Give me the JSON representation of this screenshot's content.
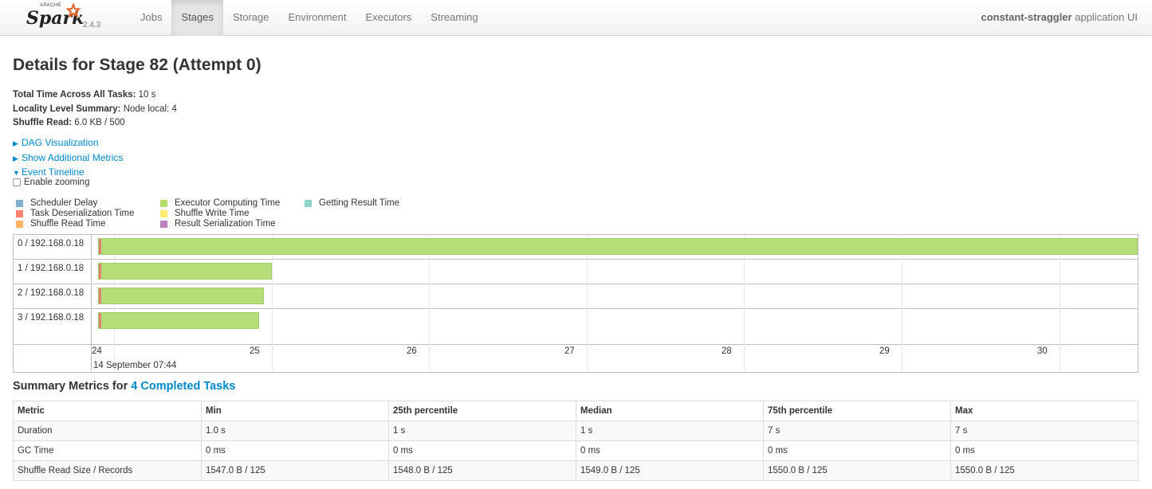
{
  "brand": {
    "apache": "APACHE",
    "name": "Spark",
    "version": "2.4.3"
  },
  "nav": [
    {
      "label": "Jobs",
      "active": false
    },
    {
      "label": "Stages",
      "active": true
    },
    {
      "label": "Storage",
      "active": false
    },
    {
      "label": "Environment",
      "active": false
    },
    {
      "label": "Executors",
      "active": false
    },
    {
      "label": "Streaming",
      "active": false
    }
  ],
  "app": {
    "name": "constant-straggler",
    "suffix": " application UI"
  },
  "page": {
    "title": "Details for Stage 82 (Attempt 0)"
  },
  "summary": [
    {
      "label": "Total Time Across All Tasks:",
      "value": " 10 s"
    },
    {
      "label": "Locality Level Summary:",
      "value": " Node local: 4"
    },
    {
      "label": "Shuffle Read:",
      "value": " 6.0 KB / 500"
    }
  ],
  "toggles": [
    {
      "label": "DAG Visualization",
      "expanded": false
    },
    {
      "label": "Show Additional Metrics",
      "expanded": false
    },
    {
      "label": "Event Timeline",
      "expanded": true
    }
  ],
  "zoom": {
    "label": "Enable zooming",
    "checked": false
  },
  "legend": [
    [
      {
        "label": "Scheduler Delay",
        "color": "#80b1d3"
      },
      {
        "label": "Task Deserialization Time",
        "color": "#fb8072"
      },
      {
        "label": "Shuffle Read Time",
        "color": "#fdb462"
      }
    ],
    [
      {
        "label": "Executor Computing Time",
        "color": "#b3de69"
      },
      {
        "label": "Shuffle Write Time",
        "color": "#ffed6f"
      },
      {
        "label": "Result Serialization Time",
        "color": "#bc80bd"
      }
    ],
    [
      {
        "label": "Getting Result Time",
        "color": "#8dd3c7"
      }
    ]
  ],
  "timeline": {
    "rows": [
      "0 / 192.168.0.18",
      "1 / 192.168.0.18",
      "2 / 192.168.0.18",
      "3 / 192.168.0.18"
    ],
    "ticks": [
      "24",
      "25",
      "26",
      "27",
      "28",
      "29",
      "30"
    ],
    "date_label": "14 September 07:44",
    "task_seconds": [
      {
        "start": 23.9,
        "end": 30.5
      },
      {
        "start": 23.9,
        "end": 25.0
      },
      {
        "start": 23.9,
        "end": 24.95
      },
      {
        "start": 23.9,
        "end": 24.92
      }
    ]
  },
  "metrics": {
    "title_prefix": "Summary Metrics for ",
    "title_link": "4 Completed Tasks",
    "headers": [
      "Metric",
      "Min",
      "25th percentile",
      "Median",
      "75th percentile",
      "Max"
    ],
    "rows": [
      [
        "Duration",
        "1.0 s",
        "1 s",
        "1 s",
        "7 s",
        "7 s"
      ],
      [
        "GC Time",
        "0 ms",
        "0 ms",
        "0 ms",
        "0 ms",
        "0 ms"
      ],
      [
        "Shuffle Read Size / Records",
        "1547.0 B / 125",
        "1548.0 B / 125",
        "1549.0 B / 125",
        "1550.0 B / 125",
        "1550.0 B / 125"
      ]
    ]
  }
}
